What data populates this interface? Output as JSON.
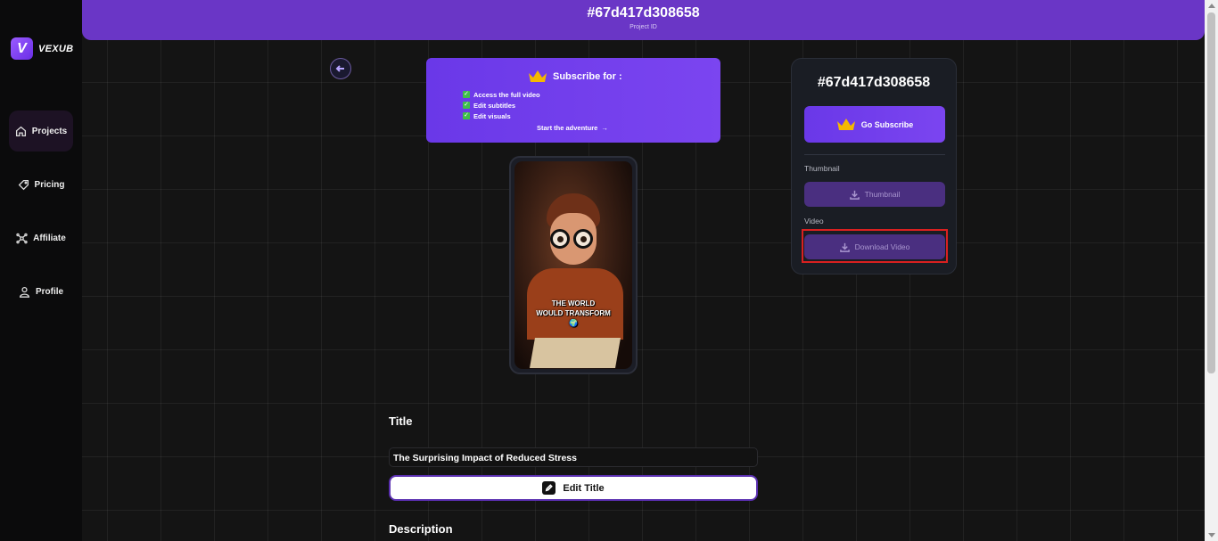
{
  "brand": {
    "logo_letter": "V",
    "name": "VEXUB"
  },
  "sidebar": {
    "items": [
      {
        "label": "Projects",
        "icon": "home-icon",
        "active": true
      },
      {
        "label": "Pricing",
        "icon": "tag-icon",
        "active": false
      },
      {
        "label": "Affiliate",
        "icon": "network-icon",
        "active": false
      },
      {
        "label": "Profile",
        "icon": "user-icon",
        "active": false
      }
    ]
  },
  "header": {
    "project_id": "#67d417d308658",
    "subtitle": "Project ID"
  },
  "subscribe_banner": {
    "heading": "Subscribe for :",
    "benefits": [
      "Access the full video",
      "Edit subtitles",
      "Edit visuals"
    ],
    "cta": "Start the adventure",
    "cta_arrow": "→"
  },
  "preview": {
    "caption_line1": "THE WORLD",
    "caption_line2": "WOULD TRANSFORM",
    "caption_emoji": "🌍"
  },
  "panel": {
    "project_id": "#67d417d308658",
    "go_subscribe_label": "Go Subscribe",
    "thumbnail_section": "Thumbnail",
    "thumbnail_button": "Thumbnail",
    "video_section": "Video",
    "download_video_button": "Download Video"
  },
  "title_section": {
    "heading": "Title",
    "value": "The Surprising Impact of Reduced Stress",
    "edit_button": "Edit Title"
  },
  "description_section": {
    "heading": "Description"
  },
  "colors": {
    "accent": "#6a36c6",
    "button_purple": "#4a2f80",
    "highlight_red": "#d92020"
  }
}
